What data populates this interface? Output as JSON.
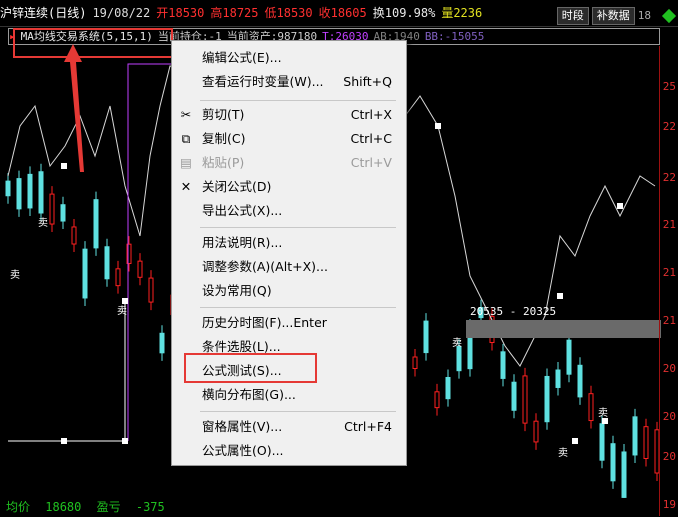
{
  "topbar": {
    "symbol": "沪锌连续(日线)",
    "date": "19/08/22",
    "open": "开18530",
    "high": "高18725",
    "low": "低18530",
    "close": "收18605",
    "turnover": "换109.98%",
    "volume": "量2236",
    "btn_time": "时段",
    "btn_fill": "补数据",
    "hidden_tail": "18"
  },
  "legend": {
    "title": "MA均线交易系统(5,15,1)",
    "position": "当前持仓:-1",
    "assets": "当前资产:987180",
    "t": "T:26030",
    "ab": "AB:1940",
    "bb": "BB:-15055"
  },
  "price_axis": [
    "25",
    "22",
    "22",
    "21",
    "21",
    "21",
    "20",
    "20",
    "20",
    "19",
    "19",
    "19"
  ],
  "band_label": "20535 - 20325",
  "bottombar": {
    "avg_label": "均价",
    "avg_value": "18680",
    "pnl_label": "盈亏",
    "pnl_value": "-375"
  },
  "context_menu": {
    "items": [
      {
        "label": "编辑公式(E)...",
        "shortcut": "",
        "icon": ""
      },
      {
        "label": "查看运行时变量(W)...",
        "shortcut": "Shift+Q",
        "icon": ""
      },
      {
        "label": "剪切(T)",
        "shortcut": "Ctrl+X",
        "icon": "scissors-icon"
      },
      {
        "label": "复制(C)",
        "shortcut": "Ctrl+C",
        "icon": "copy-icon"
      },
      {
        "label": "粘贴(P)",
        "shortcut": "Ctrl+V",
        "icon": "paste-icon"
      },
      {
        "label": "关闭公式(D)",
        "shortcut": "",
        "icon": "close-icon"
      },
      {
        "label": "导出公式(X)...",
        "shortcut": "",
        "icon": ""
      },
      {
        "label": "用法说明(R)...",
        "shortcut": "",
        "icon": ""
      },
      {
        "label": "调整参数(A)(Alt+X)...",
        "shortcut": "",
        "icon": ""
      },
      {
        "label": "设为常用(Q)",
        "shortcut": "",
        "icon": ""
      },
      {
        "label": "历史分时图(F)...Enter",
        "shortcut": "",
        "icon": ""
      },
      {
        "label": "条件选股(L)...",
        "shortcut": "",
        "icon": ""
      },
      {
        "label": "公式测试(S)...",
        "shortcut": "",
        "icon": ""
      },
      {
        "label": "横向分布图(G)...",
        "shortcut": "",
        "icon": ""
      },
      {
        "label": "窗格属性(V)...",
        "shortcut": "Ctrl+F4",
        "icon": ""
      },
      {
        "label": "公式属性(O)...",
        "shortcut": "",
        "icon": ""
      }
    ]
  },
  "chart_labels": [
    "卖",
    "卖",
    "卖",
    "卖",
    "卖",
    "卖"
  ],
  "colors": {
    "red": "#ff2020",
    "cyan": "#5fe0e0",
    "white": "#ffffff",
    "green": "#20c020",
    "magenta": "#c040ff",
    "highlight": "#e53935"
  }
}
